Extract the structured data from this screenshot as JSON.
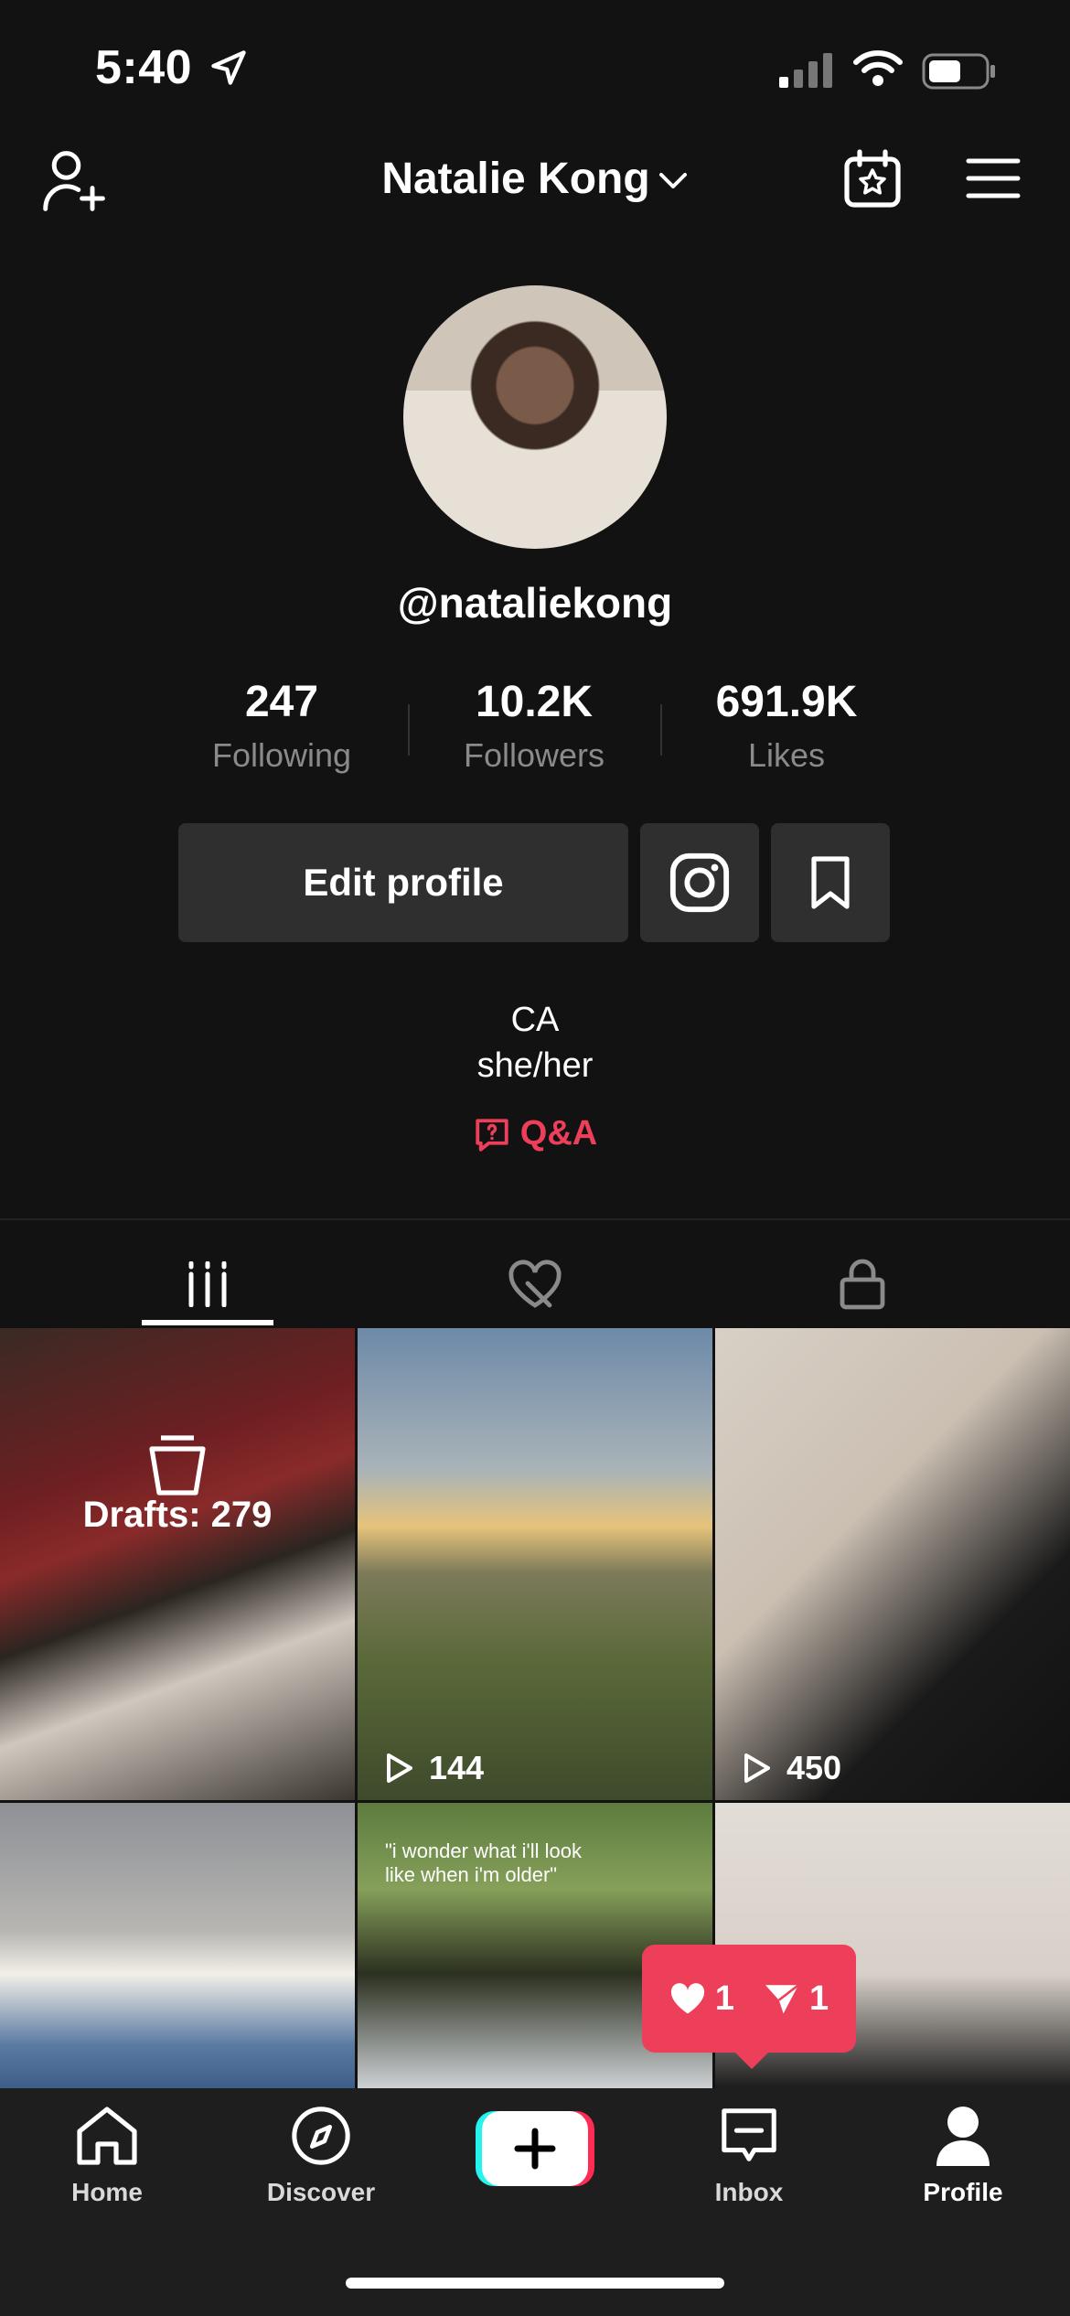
{
  "status": {
    "time": "5:40"
  },
  "header": {
    "username": "Natalie Kong"
  },
  "profile": {
    "handle": "@nataliekong",
    "stats": [
      {
        "value": "247",
        "label": "Following"
      },
      {
        "value": "10.2K",
        "label": "Followers"
      },
      {
        "value": "691.9K",
        "label": "Likes"
      }
    ],
    "edit_label": "Edit profile",
    "bio": [
      "CA",
      "she/her"
    ],
    "qa_label": "Q&A"
  },
  "grid": {
    "drafts_label": "Drafts: 279",
    "tiles": [
      {
        "views": "144"
      },
      {
        "views": "450"
      }
    ],
    "caption": "\"i wonder what i'll look\nlike when i'm older\""
  },
  "notification": {
    "likes": "1",
    "shares": "1"
  },
  "nav": {
    "items": [
      {
        "label": "Home"
      },
      {
        "label": "Discover"
      },
      {
        "label": "Inbox"
      },
      {
        "label": "Profile"
      }
    ]
  },
  "colors": {
    "accent": "#ee3f5a",
    "background": "#121212",
    "nav": "#1e1e1e"
  }
}
